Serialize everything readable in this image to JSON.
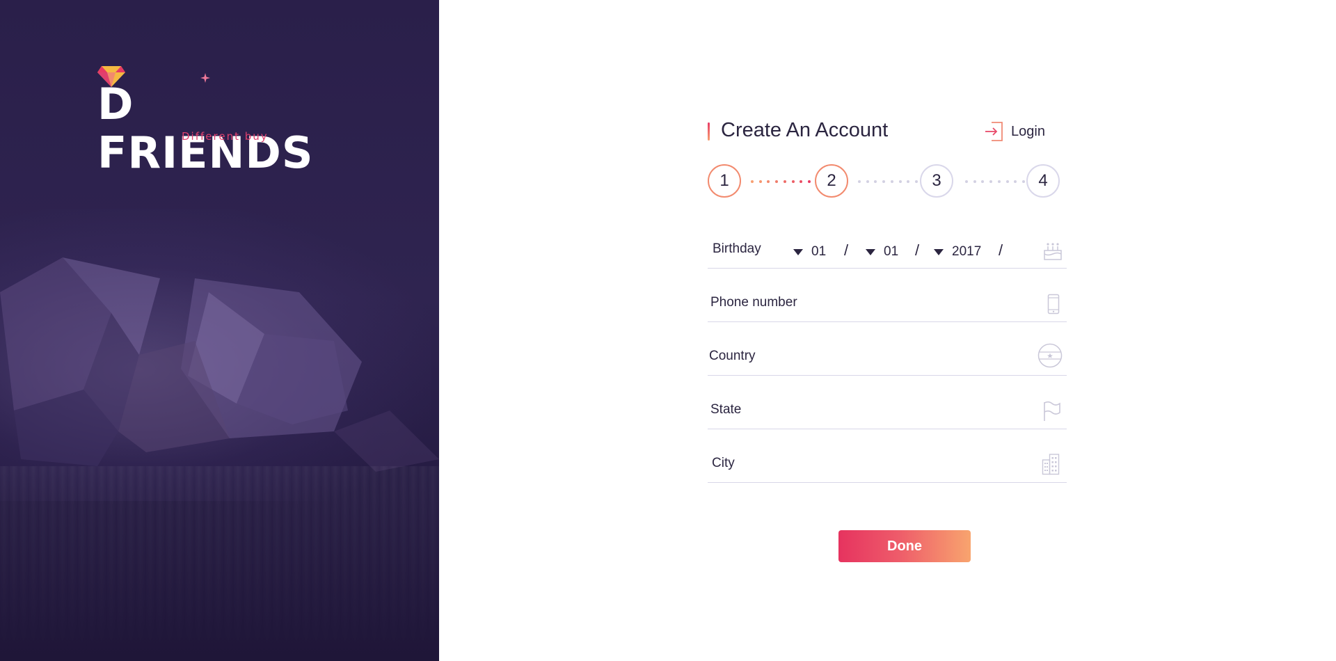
{
  "brand": {
    "name": "D FRIENDS",
    "tagline": "Different buy",
    "colors": {
      "panel": "#2a1f4a",
      "accent_pink": "#e83a64",
      "accent_orange": "#f7a072",
      "gem_gold": "#f5b942"
    }
  },
  "header": {
    "title": "Create An Account",
    "login_label": "Login",
    "login_icon": "login-arrow-icon"
  },
  "steps": {
    "items": [
      "1",
      "2",
      "3",
      "4"
    ],
    "current": "2"
  },
  "form": {
    "birthday": {
      "label": "Birthday",
      "day": "01",
      "month": "01",
      "year": "2017",
      "separator": "/",
      "icon": "birthday-cake-icon"
    },
    "phone": {
      "label": "Phone number",
      "icon": "phone-icon"
    },
    "country": {
      "label": "Country",
      "icon": "globe-icon"
    },
    "state": {
      "label": "State",
      "icon": "flag-icon"
    },
    "city": {
      "label": "City",
      "icon": "building-icon"
    }
  },
  "actions": {
    "done_label": "Done"
  }
}
